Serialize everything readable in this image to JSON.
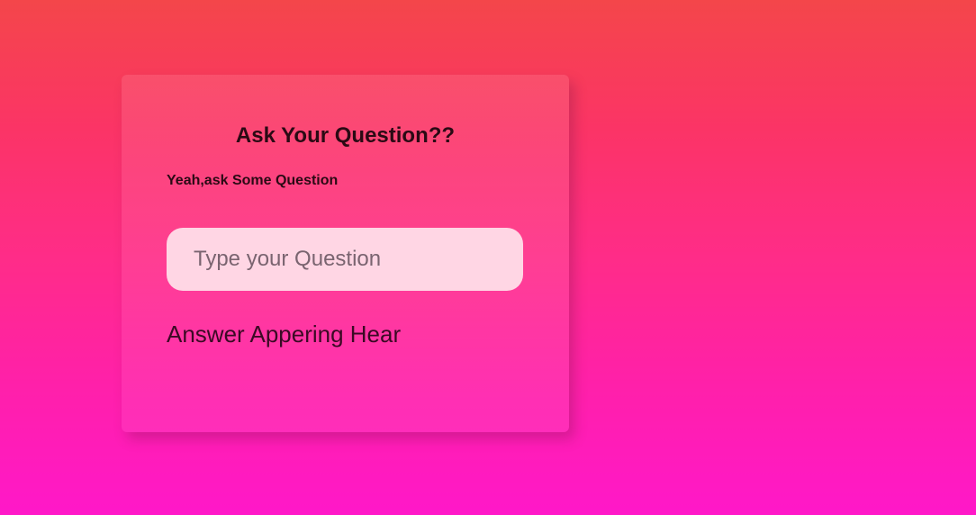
{
  "card": {
    "title": "Ask Your Question??",
    "subtitle": "Yeah,ask Some Question",
    "input_placeholder": "Type your Question",
    "input_value": "",
    "answer_text": "Answer Appering Hear"
  },
  "colors": {
    "background_top": "#f4464a",
    "background_bottom": "#ff18c9",
    "input_background": "#ffd6e4",
    "text_dark": "#2a0a14"
  }
}
